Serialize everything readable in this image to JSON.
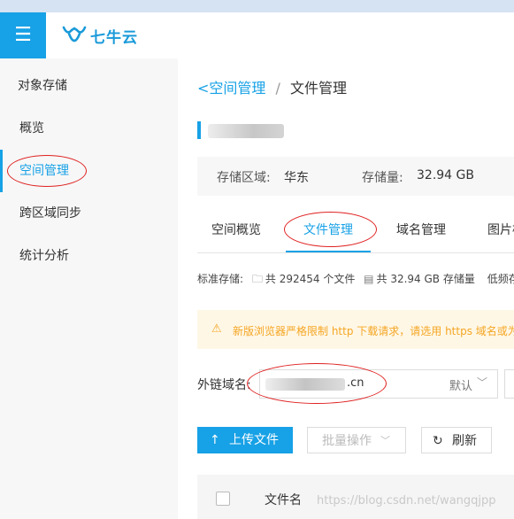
{
  "header": {
    "menu_icon": "hamburger-menu-icon",
    "logo_text": "七牛云",
    "logo_icon": "qiniu-cow-icon"
  },
  "sidebar": {
    "title": "对象存储",
    "items": [
      {
        "label": "概览"
      },
      {
        "label": "空间管理",
        "active": true
      },
      {
        "label": "跨区域同步"
      },
      {
        "label": "统计分析"
      }
    ]
  },
  "breadcrumb": {
    "back_label": "空间管理",
    "separator": "/",
    "current": "文件管理"
  },
  "bucket_info": {
    "region_label": "存储区域:",
    "region_value": "华东",
    "storage_label": "存储量:",
    "storage_value": "32.94 GB"
  },
  "tabs": [
    {
      "label": "空间概览"
    },
    {
      "label": "文件管理",
      "active": true
    },
    {
      "label": "域名管理"
    },
    {
      "label": "图片样式"
    }
  ],
  "stats": {
    "type_label": "标准存储:",
    "file_count": "共 292454 个文件",
    "storage_total": "共 32.94 GB 存储量",
    "low_freq": "低频存储"
  },
  "warning": {
    "icon": "warning-triangle-icon",
    "text": "新版浏览器严格限制 http 下载请求，请选用 https 域名或为域名"
  },
  "domain": {
    "label": "外链域名:",
    "value_suffix": ".cn",
    "default_tag": "默认"
  },
  "toolbar": {
    "upload_label": "上传文件",
    "batch_label": "批量操作",
    "refresh_label": "刷新"
  },
  "table": {
    "header_name": "文件名"
  },
  "watermark": "https://blog.csdn.net/wangqjpp",
  "colors": {
    "accent": "#17a1e6",
    "warning_text": "#f5a623",
    "warning_bg": "#fff7e6",
    "annotation": "#e02020"
  }
}
